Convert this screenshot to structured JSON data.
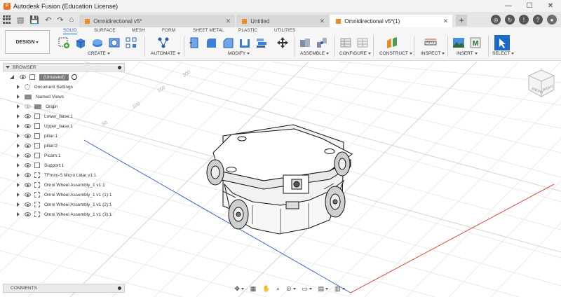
{
  "window": {
    "title": "Autodesk Fusion (Education License)",
    "controls": {
      "minimize": "—",
      "maximize": "☐",
      "close": "✕"
    }
  },
  "tabs": [
    {
      "label": "Omnidirectional v5*",
      "active": false
    },
    {
      "label": "Untitled",
      "active": false
    },
    {
      "label": "Omnidirectional v5*(1)",
      "active": true
    }
  ],
  "toolbar": {
    "workspace": "DESIGN",
    "workspace_tabs": [
      "SOLID",
      "SURFACE",
      "MESH",
      "FORM",
      "SHEET METAL",
      "PLASTIC",
      "UTILITIES"
    ],
    "active_workspace_tab": "SOLID",
    "groups": [
      "CREATE",
      "AUTOMATE",
      "MODIFY",
      "ASSEMBLE",
      "CONFIGURE",
      "CONSTRUCT",
      "INSPECT",
      "INSERT",
      "SELECT"
    ]
  },
  "browser": {
    "title": "BROWSER",
    "root": "(Unsaved)",
    "items": [
      {
        "label": "Document Settings",
        "icon": "gear-icon"
      },
      {
        "label": "Named Views",
        "icon": "folder-icon"
      },
      {
        "label": "Origin",
        "icon": "folder-icon"
      },
      {
        "label": "Lower_base:1",
        "icon": "component-icon"
      },
      {
        "label": "Upper_base:1",
        "icon": "component-icon"
      },
      {
        "label": "pillar:1",
        "icon": "component-icon"
      },
      {
        "label": "pillar:2",
        "icon": "component-icon"
      },
      {
        "label": "Picam:1",
        "icon": "component-icon"
      },
      {
        "label": "Support:1",
        "icon": "component-icon"
      },
      {
        "label": "TFmini-S Micro Lidar v1:1",
        "icon": "linked-component-icon"
      },
      {
        "label": "Omni Wheel Assembly_1 v1:1",
        "icon": "linked-component-icon"
      },
      {
        "label": "Omni Wheel Assembly_1 v1 (1):1",
        "icon": "linked-component-icon"
      },
      {
        "label": "Omni Wheel Assembly_1 v1 (2):1",
        "icon": "linked-component-icon"
      },
      {
        "label": "Omni Wheel Assembly_1 v1 (3):1",
        "icon": "linked-component-icon"
      }
    ]
  },
  "viewport": {
    "grid_labels": [
      "200",
      "150",
      "100",
      "50"
    ],
    "viewcube_faces": {
      "front": "FRONT",
      "right": "RIGHT"
    }
  },
  "comments": {
    "title": "COMMENTS"
  },
  "navbar": {
    "icons": [
      "orbit-icon",
      "look-at-icon",
      "pan-icon",
      "zoom-icon",
      "fit-icon",
      "display-settings-icon",
      "grid-settings-icon",
      "viewports-icon"
    ]
  },
  "colors": {
    "accent": "#1b6ac9",
    "title_logo": "#f37021",
    "x_axis": "#d84a3a",
    "y_axis": "#3a66c8"
  }
}
